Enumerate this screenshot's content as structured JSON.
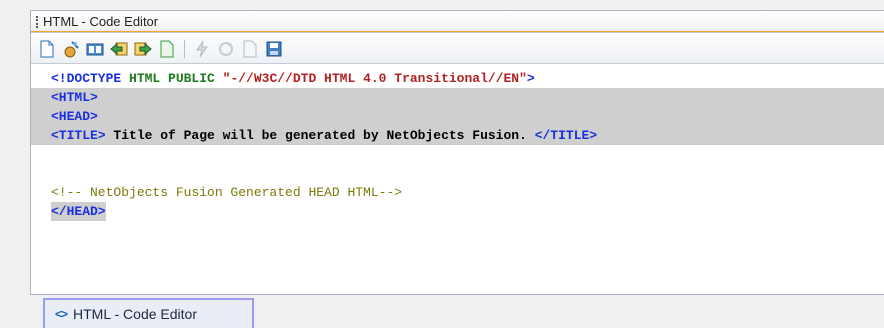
{
  "window": {
    "title": "HTML - Code Editor"
  },
  "toolbar": {
    "icons": [
      "new-page-icon",
      "wizard-icon",
      "book-icon",
      "back-arrow-icon",
      "forward-arrow-icon",
      "blank-page-icon",
      "lightning-icon",
      "refresh-icon",
      "document-icon",
      "save-icon"
    ]
  },
  "editor": {
    "lines": {
      "l1": {
        "tag": "<!DOCTYPE",
        "kw": " HTML PUBLIC ",
        "str": "\"-//W3C//DTD HTML 4.0 Transitional//EN\"",
        "end": ">"
      },
      "l2": "<HTML>",
      "l3": "<HEAD>",
      "l4": {
        "open": "<TITLE>",
        "text": " Title of Page will be generated by NetObjects Fusion. ",
        "close": "</TITLE>"
      },
      "l5": "",
      "l6": "",
      "l7": "<!-- NetObjects Fusion Generated HEAD HTML-->",
      "l8": "</HEAD>"
    }
  },
  "tab": {
    "icon": "code-brackets-icon",
    "label": "HTML - Code Editor"
  },
  "colors": {
    "tag": "#1a2fe0",
    "keyword": "#1e7a1e",
    "string": "#b22222",
    "comment": "#7a7a0a",
    "highlight": "#cfcfcf",
    "accent": "#f3a436"
  }
}
